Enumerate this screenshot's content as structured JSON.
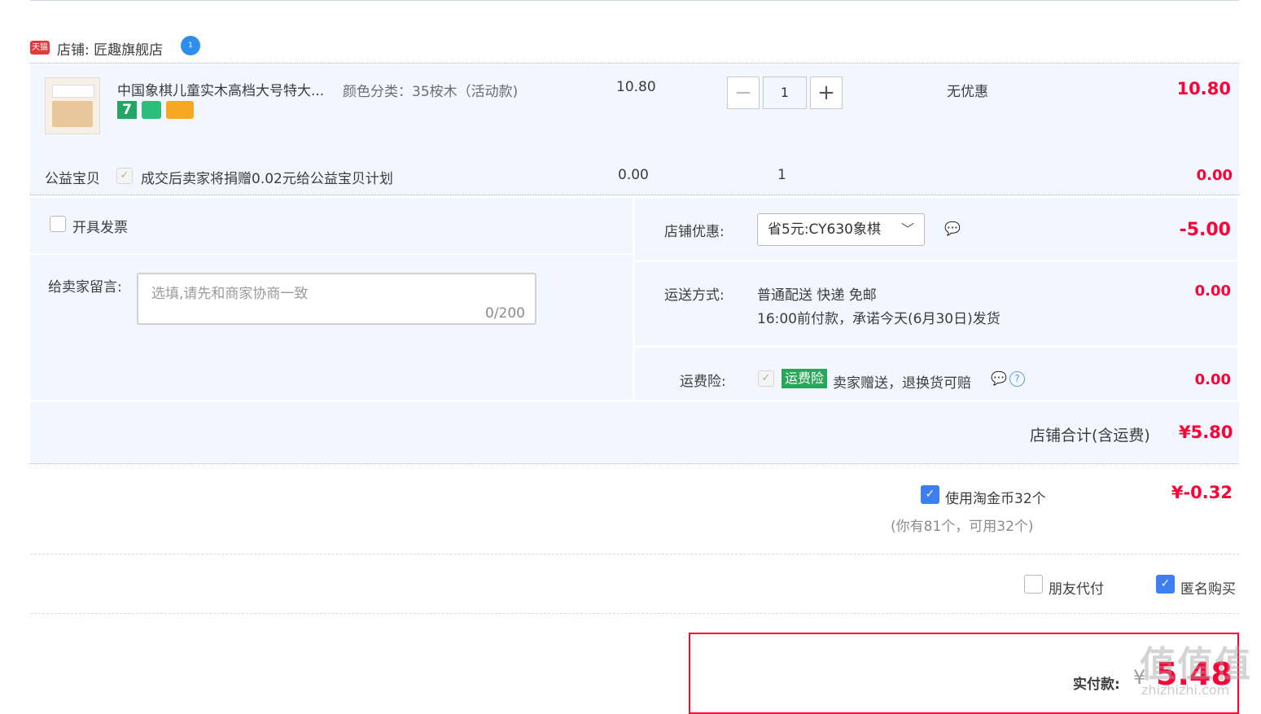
{
  "store": {
    "badge": "天猫",
    "label": "店铺: 匠趣旗舰店",
    "ww_badge": "1"
  },
  "item": {
    "title": "中国象棋儿童实木高档大号特大...",
    "spec": "颜色分类：35桉木（活动款)",
    "price": "10.80",
    "quantity": "1",
    "decrease": "−",
    "increase": "+",
    "discount": "无优惠",
    "subtotal": "10.80",
    "badges": [
      "7",
      "credit",
      "card"
    ]
  },
  "charity": {
    "label": "公益宝贝",
    "text": "成交后卖家将捐赠0.02元给公益宝贝计划",
    "price": "0.00",
    "qty": "1",
    "subtotal": "0.00"
  },
  "invoice": {
    "label": "开具发票"
  },
  "message": {
    "label": "给卖家留言:",
    "placeholder": "选填,请先和商家协商一致",
    "counter": "0/200"
  },
  "store_discount": {
    "label": "店铺优惠:",
    "selected": "省5元:CY630象棋",
    "amount": "-5.00"
  },
  "shipping": {
    "label": "运送方式:",
    "line1": "普通配送 快递 免邮",
    "line2": "16:00前付款，承诺今天(6月30日)发货",
    "amount": "0.00"
  },
  "insurance": {
    "label": "运费险:",
    "tag": "运费险",
    "text": "卖家赠送，退换货可赔",
    "amount": "0.00"
  },
  "store_total": {
    "label": "店铺合计(含运费)",
    "amount": "¥5.80"
  },
  "coins": {
    "label": "使用淘金币32个",
    "hint": "(你有81个，可用32个)",
    "amount": "¥-0.32"
  },
  "options": {
    "friend_pay": "朋友代付",
    "anonymous": "匿名购买"
  },
  "payment": {
    "label": "实付款:",
    "currency": "¥",
    "amount": "5.48"
  },
  "watermark": {
    "text": "值值值",
    "url": "zhizhizhi.com"
  },
  "colors": {
    "accent": "#ff0036",
    "panel": "#f2f7ff",
    "link": "#3d7ef0"
  }
}
